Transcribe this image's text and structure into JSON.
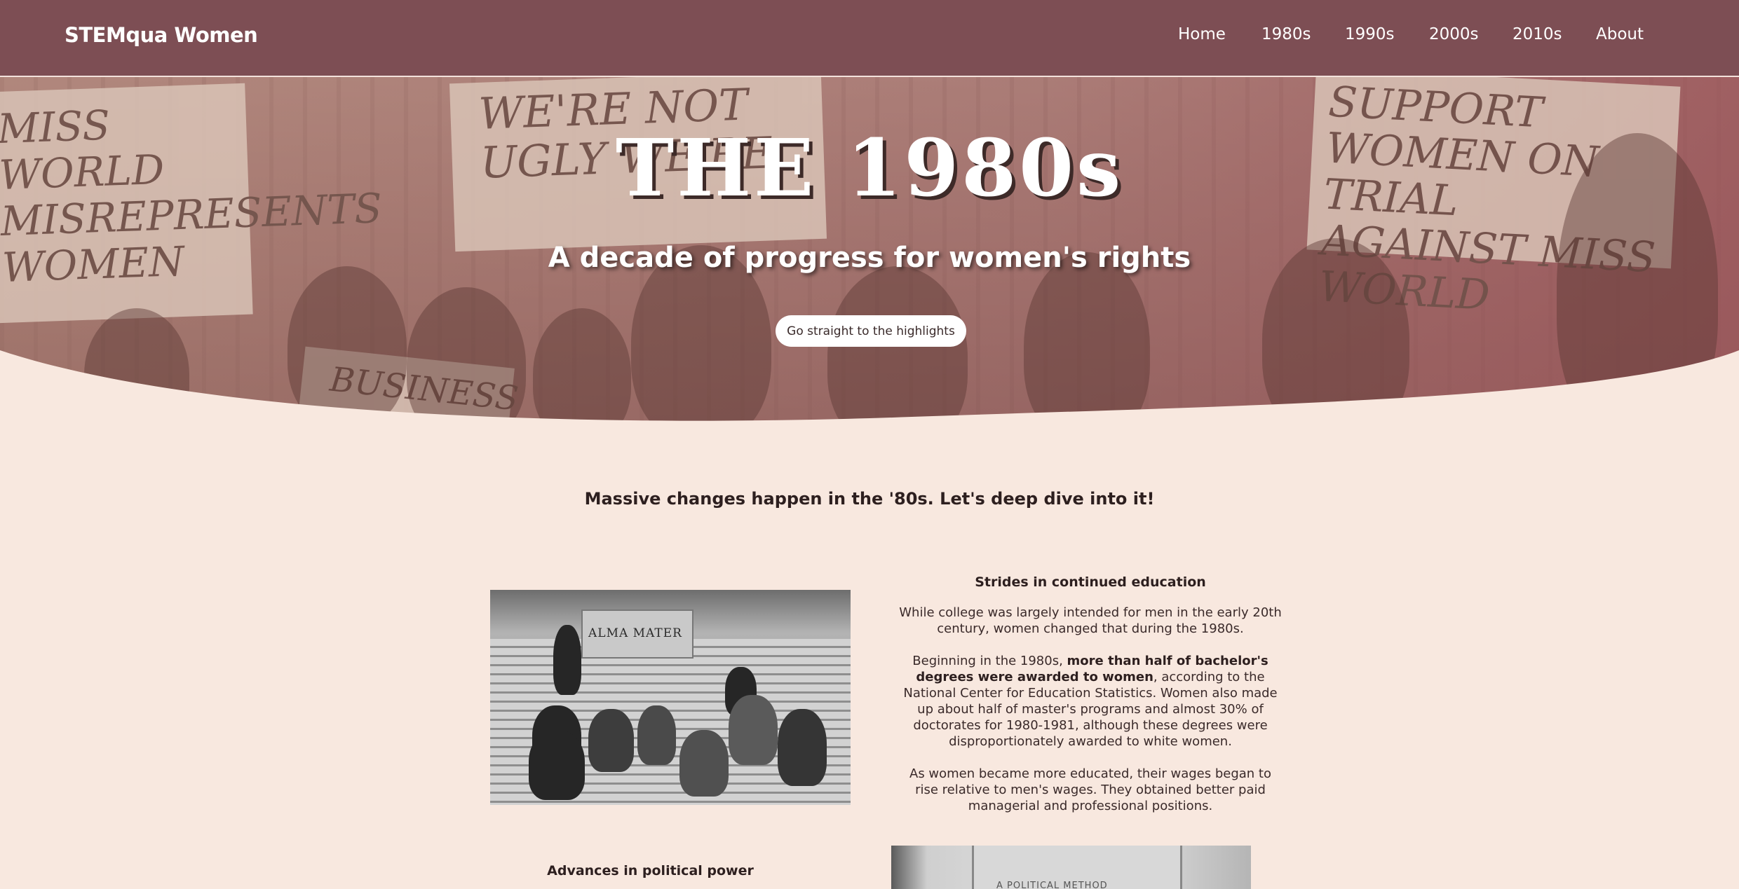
{
  "nav": {
    "brand": "STEMqua Women",
    "links": [
      "Home",
      "1980s",
      "1990s",
      "2000s",
      "2010s",
      "About"
    ]
  },
  "hero": {
    "title": "THE 1980s",
    "subtitle": "A decade of progress for women's rights",
    "button": "Go straight to the highlights",
    "signs": [
      "MISS WORLD MISREPRESENTS WOMEN",
      "WE'RE NOT UGLY WE'RE",
      "SUPPORT WOMEN ON TRIAL AGAINST MISS WORLD",
      "BUSINESS"
    ]
  },
  "main": {
    "lead": "Massive changes happen in the '80s. Let's deep dive into it!",
    "education": {
      "photo_caption": "ALMA MATER",
      "title": "Strides in continued education",
      "p1": "While college was largely intended for men in the early 20th century, women changed that during the 1980s.",
      "p2_pre": "Beginning in the 1980s, ",
      "p2_bold": "more than half of bachelor's degrees were awarded to women",
      "p2_post": ", according to the National Center for Education Statistics. Women also made up about half of master's programs and almost 30% of doctorates for 1980-1981, although these degrees were disproportionately awarded to white women.",
      "p3": "As women became more educated, their wages began to rise relative to men's wages. They obtained better paid managerial and professional positions."
    },
    "political": {
      "title": "Advances in political power",
      "photo_caption": "A POLITICAL METHOD"
    }
  },
  "colors": {
    "nav_bg": "#7d4e54",
    "page_bg": "#f8e8df",
    "text": "#3a2a2a"
  }
}
